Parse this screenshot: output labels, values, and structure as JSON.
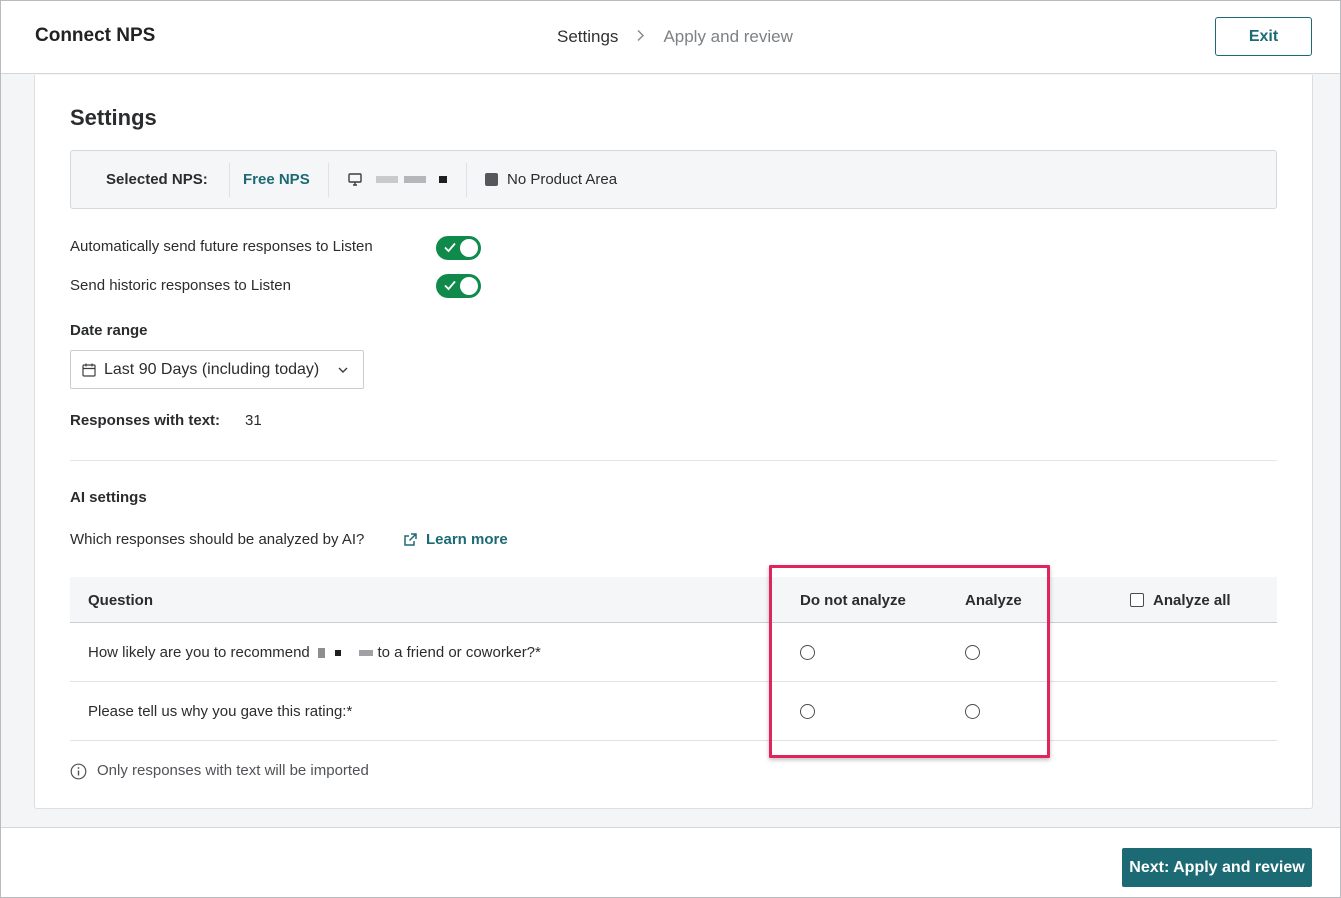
{
  "header": {
    "app_title": "Connect NPS",
    "steps": [
      {
        "label": "Settings",
        "active": true
      },
      {
        "label": "Apply and review",
        "active": false
      }
    ],
    "exit_label": "Exit"
  },
  "settings": {
    "title": "Settings",
    "selected_nps": {
      "label": "Selected NPS:",
      "nps_name": "Free NPS",
      "product_area": "No Product Area"
    },
    "toggles": [
      {
        "label": "Automatically send future responses to Listen",
        "on": true
      },
      {
        "label": "Send historic responses to Listen",
        "on": true
      }
    ],
    "date_range": {
      "label": "Date range",
      "value": "Last 90 Days (including today)"
    },
    "responses_with_text": {
      "label": "Responses with text:",
      "value": "31"
    }
  },
  "ai_settings": {
    "title": "AI settings",
    "question": "Which responses should be analyzed by AI?",
    "learn_more": "Learn more",
    "table": {
      "headers": {
        "question": "Question",
        "do_not_analyze": "Do not analyze",
        "analyze": "Analyze",
        "analyze_all": "Analyze all"
      },
      "rows": [
        {
          "question_start": "How likely are you to recommend",
          "question_end": "to a friend or coworker?*"
        },
        {
          "question": "Please tell us why you gave this rating:*"
        }
      ]
    },
    "note": "Only responses with text will be imported"
  },
  "footer": {
    "next_label": "Next: Apply and review"
  },
  "colors": {
    "accent": "#1c6b74",
    "toggle_on": "#0f8a4a",
    "highlight": "#e0245e"
  }
}
